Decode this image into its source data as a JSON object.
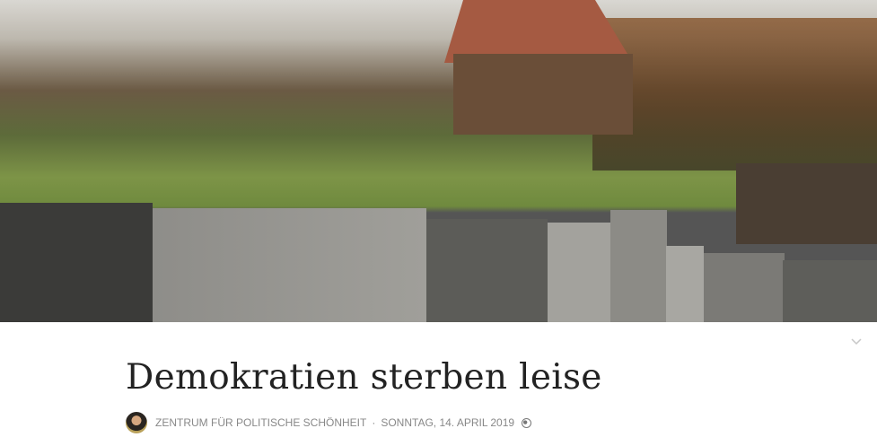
{
  "post": {
    "title": "Demokratien sterben leise",
    "author": "Zentrum für politische Schönheit",
    "separator": "·",
    "date": "Sonntag, 14. April 2019",
    "visibility_icon": "globe-icon"
  },
  "hero": {
    "alt_icon": "hero-image"
  },
  "toggle": {
    "icon": "chevron-down-icon"
  }
}
